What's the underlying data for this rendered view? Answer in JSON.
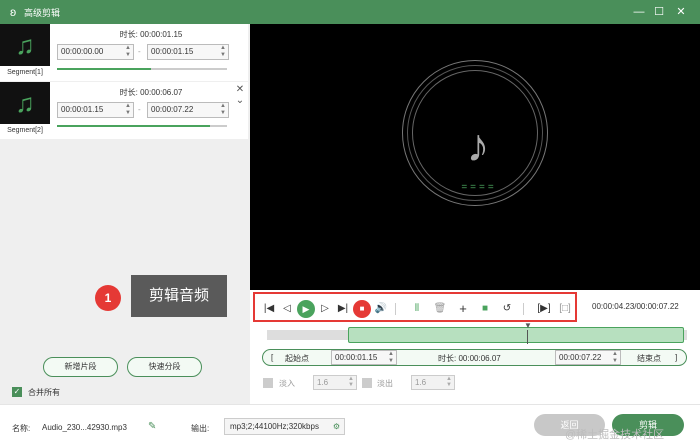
{
  "window": {
    "title": "高级剪辑",
    "minimize": "—",
    "maximize": "☐",
    "close": "✕"
  },
  "segments": [
    {
      "label": "Segment[1]",
      "duration_label": "时长:",
      "duration": "00:00:01.15",
      "start": "00:00:00.00",
      "end": "00:00:01.15",
      "progress": 0.55
    },
    {
      "label": "Segment[2]",
      "duration_label": "时长:",
      "duration": "00:00:06.07",
      "start": "00:00:01.15",
      "end": "00:00:07.22",
      "progress": 0.9
    }
  ],
  "left_buttons": {
    "add_segment": "新增片段",
    "quick_split": "快速分段"
  },
  "merge_all": {
    "label": "合并所有",
    "checked": true
  },
  "callout": {
    "number": "1",
    "text": "剪辑音频"
  },
  "playback": {
    "time": "00:00:04.23/00:00:07.22"
  },
  "range": {
    "start_label": "起始点",
    "start_value": "00:00:01.15",
    "duration_label": "时长:",
    "duration_value": "00:00:06.07",
    "end_value": "00:00:07.22",
    "end_label": "结束点",
    "open_bracket": "[",
    "close_bracket": "]"
  },
  "fade": {
    "in_label": "淡入",
    "in_value": "1.6",
    "out_label": "淡出",
    "out_value": "1.6"
  },
  "footer": {
    "name_label": "名称:",
    "name_value": "Audio_230...42930.mp3",
    "output_label": "输出:",
    "output_value": "mp3;2;44100Hz;320kbps",
    "return_button": "返回",
    "cut_button": "剪辑"
  },
  "watermark": "@稀土掘金技术社区",
  "colors": {
    "accent": "#4a8f5a",
    "highlight": "#e53935",
    "selection": "#b7e0bf"
  }
}
